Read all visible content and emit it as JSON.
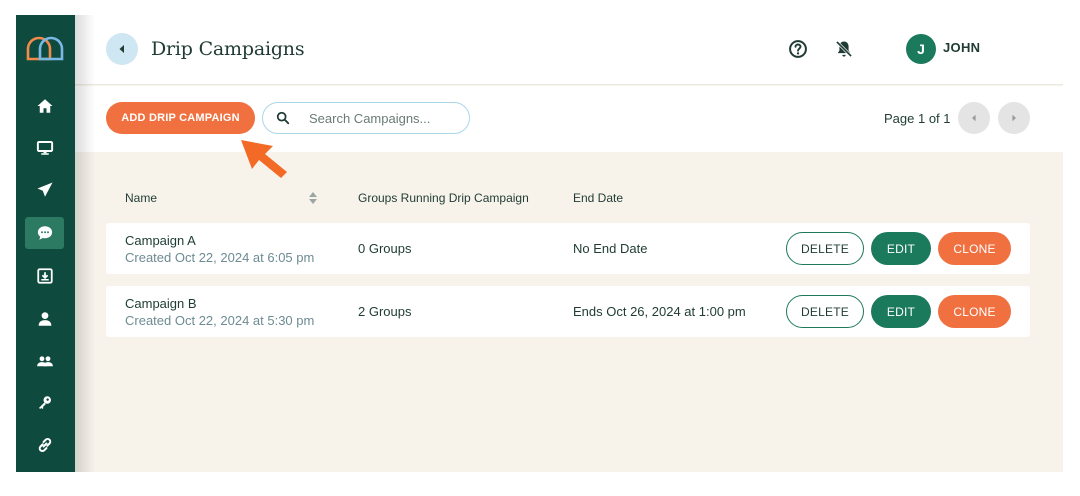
{
  "header": {
    "title": "Drip Campaigns",
    "user_initial": "J",
    "user_name": "JOHN"
  },
  "sidebar": {
    "items": [
      {
        "name": "home-icon",
        "active": false
      },
      {
        "name": "monitor-icon",
        "active": false
      },
      {
        "name": "send-icon",
        "active": false
      },
      {
        "name": "chat-bubble-icon",
        "active": true
      },
      {
        "name": "inbox-download-icon",
        "active": false
      },
      {
        "name": "person-icon",
        "active": false
      },
      {
        "name": "group-icon",
        "active": false
      },
      {
        "name": "key-icon",
        "active": false
      },
      {
        "name": "link-icon",
        "active": false
      }
    ]
  },
  "toolbar": {
    "add_label": "ADD DRIP CAMPAIGN",
    "search_placeholder": "Search Campaigns...",
    "page_label": "Page 1 of 1"
  },
  "table": {
    "columns": [
      "Name",
      "Groups Running Drip Campaign",
      "End Date"
    ],
    "rows": [
      {
        "name": "Campaign A",
        "created": "Created Oct 22, 2024 at 6:05 pm",
        "groups": "0 Groups",
        "end_date": "No End Date"
      },
      {
        "name": "Campaign B",
        "created": "Created Oct 22, 2024 at 5:30 pm",
        "groups": "2 Groups",
        "end_date": "Ends Oct 26, 2024 at 1:00 pm"
      }
    ],
    "actions": {
      "delete": "DELETE",
      "edit": "EDIT",
      "clone": "CLONE"
    }
  },
  "colors": {
    "sidebar": "#0e4a3d",
    "accent_orange": "#f07040",
    "accent_green": "#1c7a5c",
    "content_bg": "#f7f3eb"
  }
}
